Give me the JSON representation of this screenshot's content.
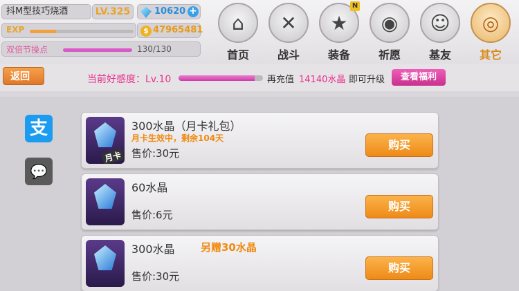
{
  "profile": {
    "name": "抖M型技巧烧酒",
    "level": "LV.325",
    "gems": "10620",
    "exp_label": "EXP",
    "exp_progress": 0.25,
    "gold": "47965481",
    "event_label": "双倍节操点",
    "event_value": "130/130",
    "event_progress": 1.0
  },
  "nav": [
    {
      "label": "首页",
      "icon": "house-icon",
      "active": false
    },
    {
      "label": "战斗",
      "icon": "crossed-guns-icon",
      "active": false
    },
    {
      "label": "装备",
      "icon": "star-gun-icon",
      "active": false,
      "badge": "N"
    },
    {
      "label": "祈愿",
      "icon": "egg-icon",
      "active": false
    },
    {
      "label": "基友",
      "icon": "friend-face-icon",
      "active": false
    },
    {
      "label": "其它",
      "icon": "target-icon",
      "active": true
    }
  ],
  "info": {
    "back_label": "返回",
    "affinity_label": "当前好感度：Lv.10",
    "affinity_progress": 0.9,
    "recharge_prefix": "再充值",
    "recharge_amount": "14140水晶",
    "recharge_suffix": "即可升级",
    "benefit_label": "查看福利"
  },
  "payment": {
    "alipay_glyph": "支",
    "wechat_glyph": "💬"
  },
  "products": [
    {
      "title": "300水晶（月卡礼包）",
      "subtitle": "月卡生效中，剩余104天",
      "extra": "",
      "price": "售价:30元",
      "buy_label": "购买",
      "tag": "月卡"
    },
    {
      "title": "60水晶",
      "subtitle": "",
      "extra": "",
      "price": "售价:6元",
      "buy_label": "购买",
      "tag": ""
    },
    {
      "title": "300水晶",
      "subtitle": "",
      "extra": "另赠30水晶",
      "price": "售价:30元",
      "buy_label": "购买",
      "tag": ""
    }
  ]
}
